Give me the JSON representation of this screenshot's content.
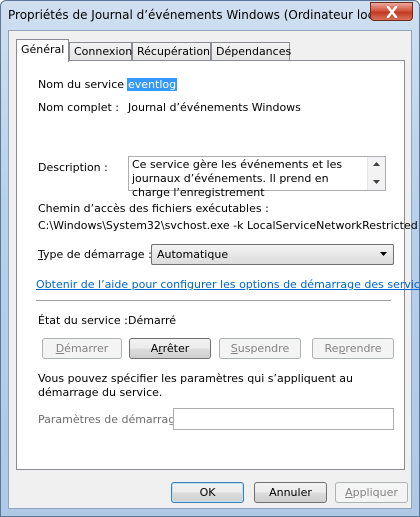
{
  "window": {
    "title": "Propriétés de Journal d’événements Windows (Ordinateur local)"
  },
  "tabs": [
    {
      "label": "Général"
    },
    {
      "label": "Connexion"
    },
    {
      "label": "Récupération"
    },
    {
      "label": "Dépendances"
    }
  ],
  "general": {
    "service_name_label": "Nom du service :",
    "service_name_value": "eventlog",
    "display_name_label": "Nom complet :",
    "display_name_value": "Journal d’événements Windows",
    "description_label": "Description :",
    "description_value": "Ce service gère les événements et les journaux d’événements. Il prend en charge l’enregistrement",
    "path_label": "Chemin d’accès des fichiers exécutables :",
    "path_value": "C:\\Windows\\System32\\svchost.exe -k LocalServiceNetworkRestricted",
    "startup_type_label_prefix": "T",
    "startup_type_label_rest": "ype de démarrage :",
    "startup_type_value": "Automatique",
    "help_link": "Obtenir de l’aide pour configurer les options de démarrage des services.",
    "status_label": "État du service :",
    "status_value": "Démarré",
    "note": "Vous pouvez spécifier les paramètres qui s’appliquent au démarrage du service.",
    "params_label": "Paramètres de démarrage :",
    "params_value": ""
  },
  "service_buttons": {
    "start": {
      "u": "D",
      "rest": "émarrer"
    },
    "stop": {
      "pre": "A",
      "u": "r",
      "rest": "rêter"
    },
    "pause": {
      "u": "S",
      "rest": "uspendre"
    },
    "resume": {
      "pre": "Re",
      "u": "p",
      "rest": "rendre"
    }
  },
  "footer": {
    "ok": "OK",
    "cancel": "Annuler",
    "apply_u": "A",
    "apply_rest": "ppliquer"
  },
  "colors": {
    "link": "#0066cc",
    "selection": "#3399ff",
    "close_button": "#c23a24"
  },
  "icons": {
    "close": "close-icon",
    "scroll_up": "chevron-up-icon",
    "scroll_down": "chevron-down-icon",
    "dropdown": "chevron-down-icon"
  }
}
